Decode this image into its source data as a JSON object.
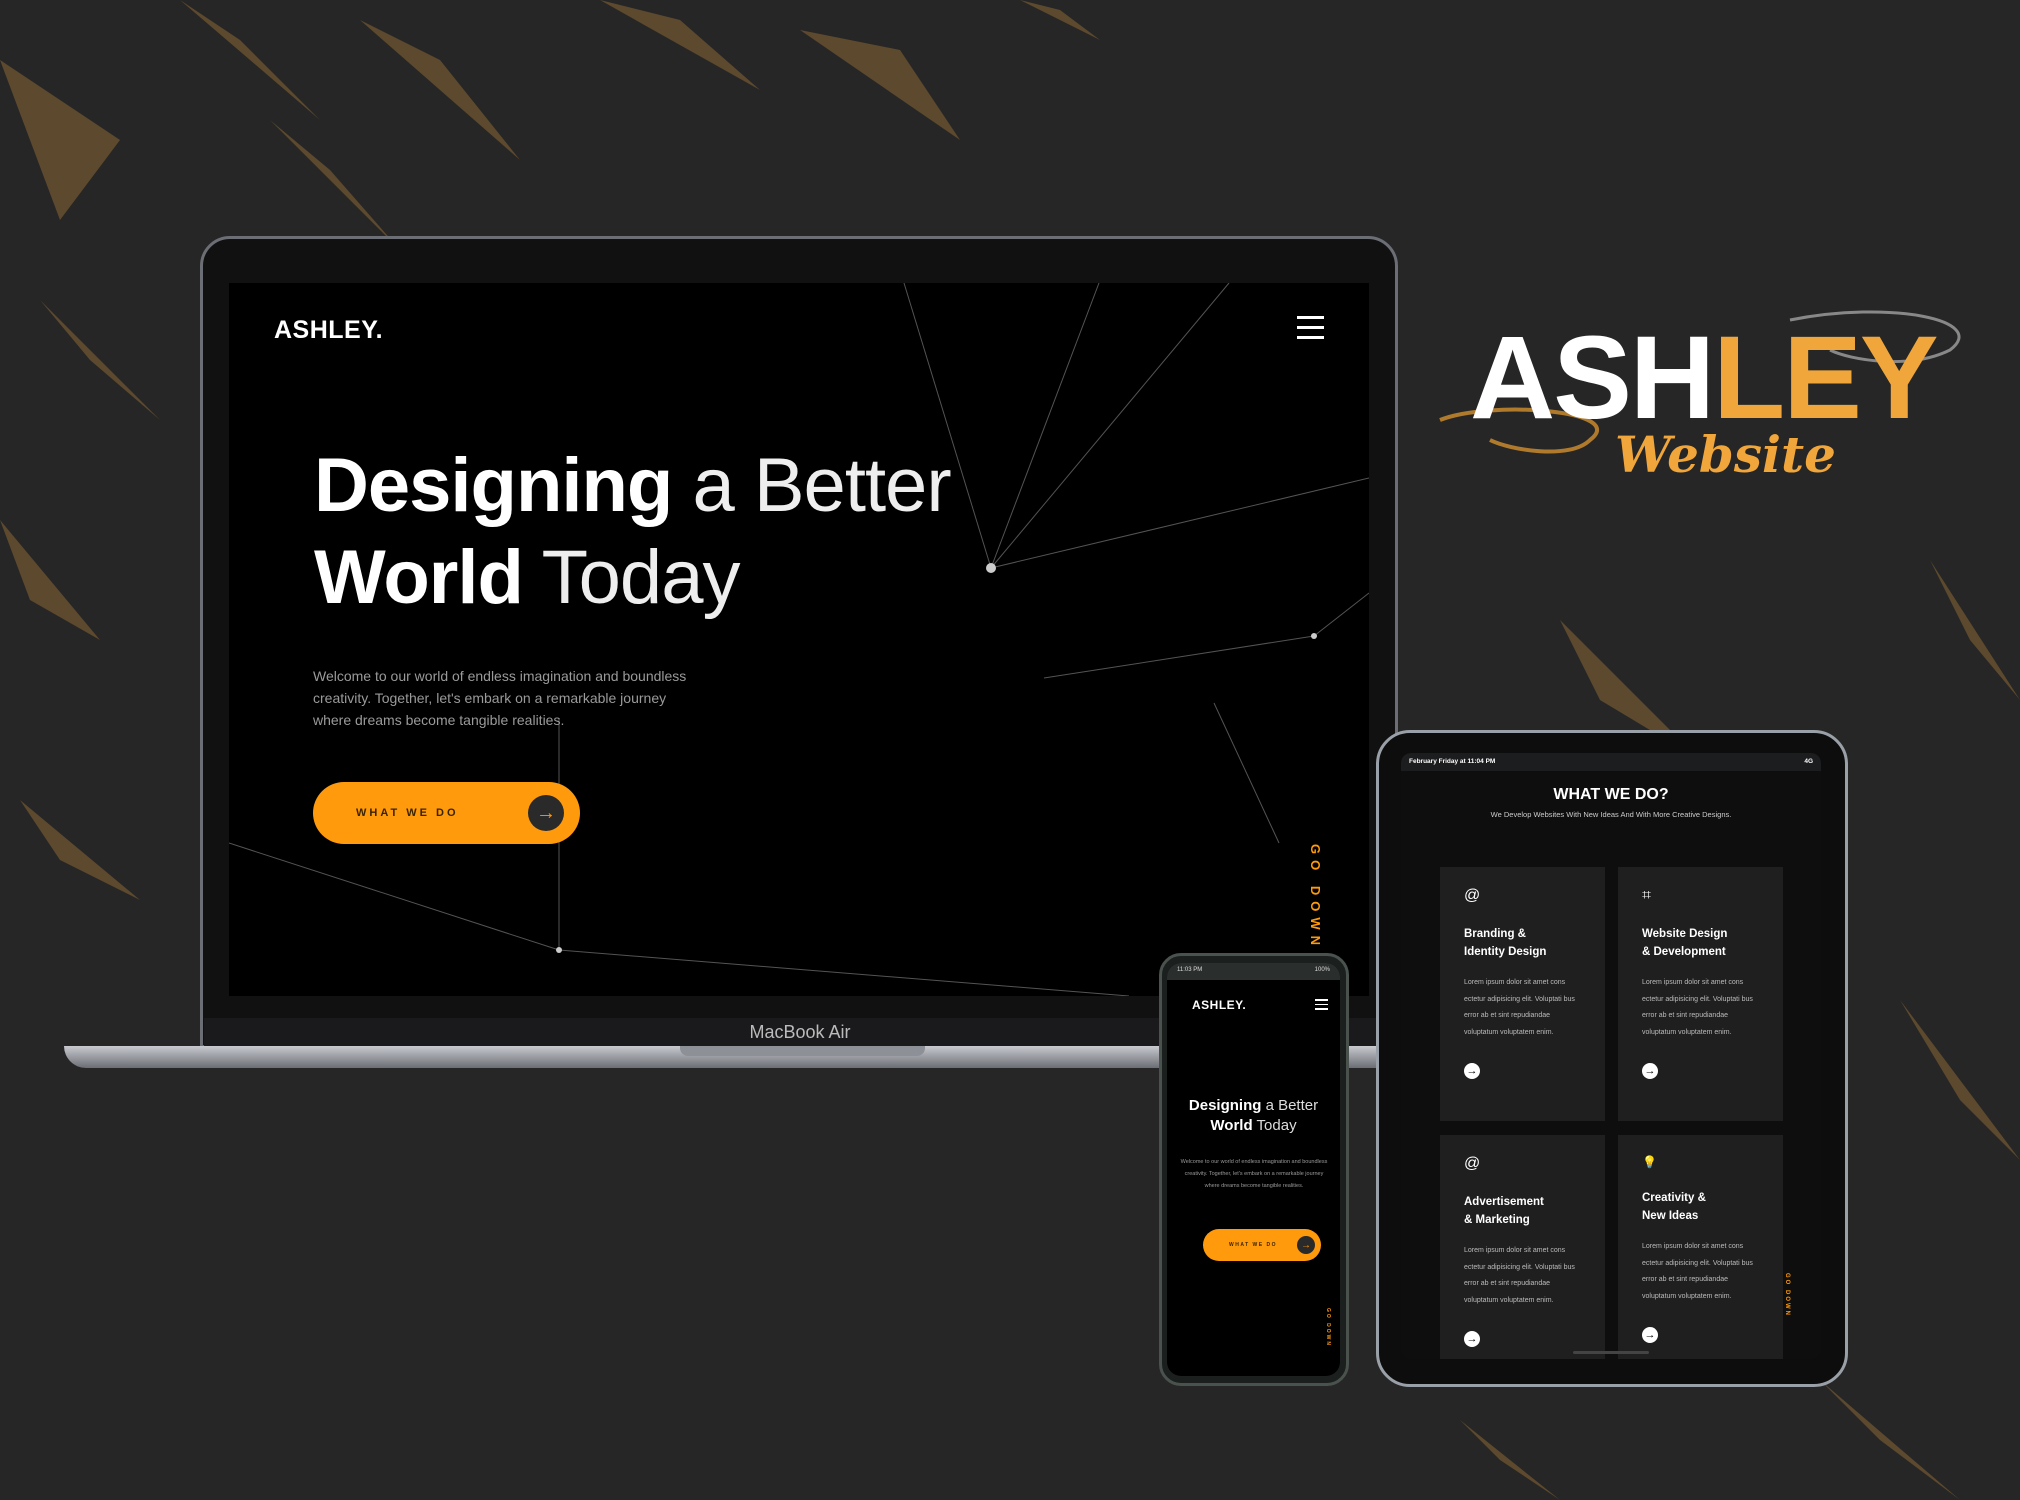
{
  "colors": {
    "accent": "#ff9a0c",
    "background": "#262626",
    "logo_accent": "#f0a63a"
  },
  "showcase_logo": {
    "part1": "ASH",
    "part2": "LEY",
    "subtitle": "Website"
  },
  "laptop": {
    "label": "MacBook Air",
    "brand": "ASHLEY.",
    "menu_icon": "hamburger-icon",
    "headline": {
      "line1_bold": "Designing",
      "line1_light": "a Better",
      "line2_bold": "World",
      "line2_light": "Today"
    },
    "intro": [
      "Welcome to our world of endless imagination and boundless",
      "creativity. Together, let's embark on a remarkable journey",
      "where dreams become tangible realities."
    ],
    "cta_label": "WHAT WE DO",
    "scroll_hint": "GO DOWN"
  },
  "tablet": {
    "status_left": "February Friday at 11:04 PM",
    "status_right": "4G",
    "title": "WHAT WE DO?",
    "subtitle": "We Develop Websites With New Ideas And With More Creative Designs.",
    "scroll_hint": "GO DOWN",
    "cards": [
      {
        "icon": "at-sign-icon",
        "glyph": "@",
        "title1": "Branding &",
        "title2": "Identity Design",
        "desc": "Lorem ipsum dolor sit amet cons ectetur adipisicing elit. Voluptati bus error ab et sint repudiandae voluptatum voluptatem enim."
      },
      {
        "icon": "figma-icon",
        "glyph": "⌗",
        "title1": "Website Design",
        "title2": "& Development",
        "desc": "Lorem ipsum dolor sit amet cons ectetur adipisicing elit. Voluptati bus error ab et sint repudiandae voluptatum voluptatem enim."
      },
      {
        "icon": "threads-icon",
        "glyph": "@",
        "title1": "Advertisement",
        "title2": "& Marketing",
        "desc": "Lorem ipsum dolor sit amet cons ectetur adipisicing elit. Voluptati bus error ab et sint repudiandae voluptatum voluptatem enim."
      },
      {
        "icon": "lightbulb-icon",
        "glyph": "💡",
        "title1": "Creativity &",
        "title2": "New Ideas",
        "desc": "Lorem ipsum dolor sit amet cons ectetur adipisicing elit. Voluptati bus error ab et sint repudiandae voluptatum voluptatem enim."
      }
    ]
  },
  "phone": {
    "status_time": "11:03 PM",
    "status_battery": "100%",
    "brand": "ASHLEY.",
    "headline": {
      "line1_bold": "Designing",
      "line1_light": "a Better",
      "line2_bold": "World",
      "line2_light": "Today"
    },
    "intro": "Welcome to our world of endless imagination and boundless creativity. Together, let's embark on a remarkable journey where dreams become tangible realities.",
    "cta_label": "WHAT WE DO",
    "scroll_hint": "GO DOWN"
  }
}
